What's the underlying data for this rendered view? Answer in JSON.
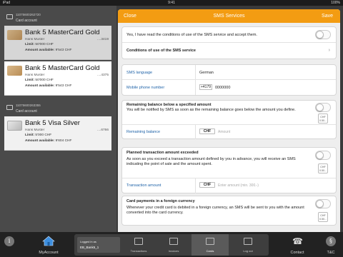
{
  "status_bar": {
    "carrier": "iPad",
    "time": "9:41",
    "battery": "100%"
  },
  "accounts": [
    {
      "number": "11075600262720",
      "label": "Card account",
      "cards": [
        {
          "name": "Bank 5 MasterCard Gold",
          "holder": "Hans Muster",
          "card_no": "....3419",
          "limit_label": "Limit:",
          "limit": "50'000 CHF",
          "available_label": "Amount available:",
          "available": "9'543 CHF"
        },
        {
          "name": "Bank 5 MasterCard Gold",
          "holder": "Hans Muster",
          "card_no": "....4375",
          "limit_label": "Limit:",
          "limit": "50'000 CHF",
          "available_label": "Amount available:",
          "available": "9'543 CHF"
        }
      ]
    },
    {
      "number": "11075600263355",
      "label": "Card account",
      "cards": [
        {
          "name": "Bank 5 Visa Silver",
          "holder": "Hans Muster",
          "card_no": "....6766",
          "limit_label": "Limit:",
          "limit": "5'000 CHF",
          "available_label": "Amount available:",
          "available": "9'604 CHF"
        }
      ]
    }
  ],
  "modal": {
    "close_label": "Close",
    "title": "SMS Services",
    "save_label": "Save",
    "accept_text": "Yes, I have read the conditions of use of the SMS service and accept them.",
    "conditions_label": "Conditions of use of the SMS service",
    "language_label": "SMS language",
    "language_value": "German",
    "phone_label": "Mobile phone number",
    "phone_prefix": "+4179",
    "phone_value": "0000000",
    "remaining": {
      "title": "Remaining balance below a specified amount",
      "desc": "You will be notified by SMS as soon as the remaining balance goes below the amount you define.",
      "fee_box": "CHF 0.50...",
      "field_label": "Remaining balance",
      "currency": "CHF",
      "placeholder": "Amount"
    },
    "planned": {
      "title": "Planned transaction amount exceeded",
      "desc": "As soon as you exceed a transaction amount defined by you in advance, you will receive an SMS indicating the point of sale and the amount spent.",
      "fee_box": "CHF 0.50...",
      "field_label": "Transaction amount",
      "currency": "CHF",
      "placeholder": "Enter amount (min. 300.-)"
    },
    "foreign": {
      "title": "Card payments in a foreign currency",
      "desc": "Whenever your credit card is debited in a foreign currency, an SMS will be sent to you with the amount converted into the card currency.",
      "fee_box": "CHF 0.50..."
    }
  },
  "tabbar": {
    "info_icon": "i",
    "myaccount_label": "MyAccount",
    "selected_account_line1": "Logged in as",
    "selected_account_line2": "EB_Bank5_1",
    "tabs": [
      "Transactions",
      "Invoices",
      "Cards",
      "Log out"
    ],
    "active_tab": "Cards",
    "contact_label": "Contact",
    "tc_label": "T&C"
  },
  "colors": {
    "accent": "#f39c12",
    "link_blue": "#1f63a8",
    "panel_bg": "#4a4a4a"
  }
}
